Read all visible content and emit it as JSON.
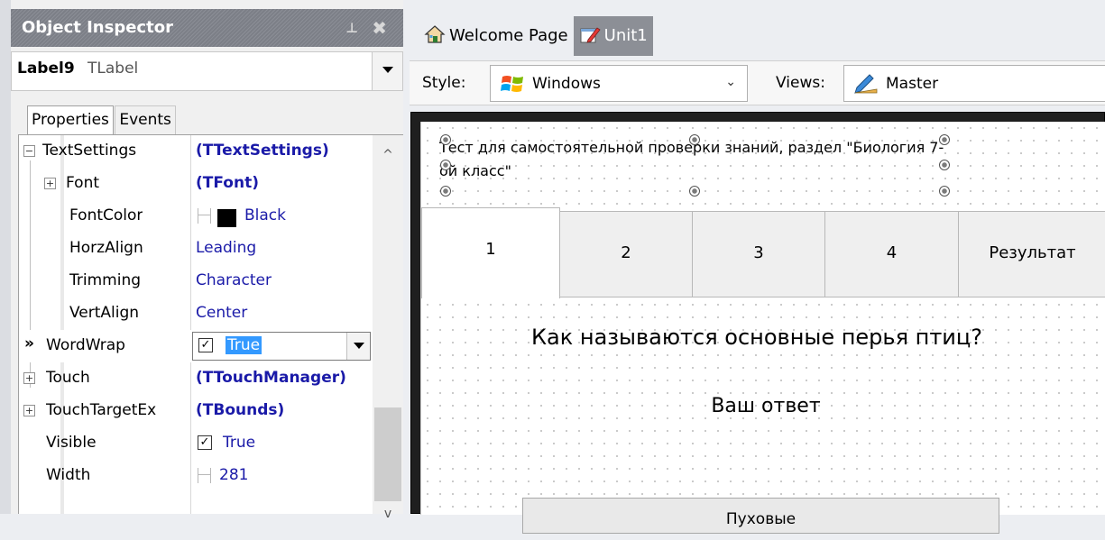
{
  "inspector": {
    "title": "Object Inspector",
    "pin_glyph": "⊥",
    "close_glyph": "✖",
    "selected_component": "Label9",
    "selected_class": "TLabel",
    "tabs": [
      "Properties",
      "Events"
    ],
    "focus_marker": "»",
    "properties": [
      {
        "name": "TextSettings",
        "value": "(TTextSettings)",
        "expander": "−"
      },
      {
        "name": "Font",
        "value": "(TFont)",
        "expander": "+"
      },
      {
        "name": "FontColor",
        "value": "Black"
      },
      {
        "name": "HorzAlign",
        "value": "Leading"
      },
      {
        "name": "Trimming",
        "value": "Character"
      },
      {
        "name": "VertAlign",
        "value": "Center"
      },
      {
        "name": "WordWrap",
        "value": "True"
      },
      {
        "name": "Touch",
        "value": "(TTouchManager)",
        "expander": "+"
      },
      {
        "name": "TouchTargetEx",
        "value": "(TBounds)",
        "expander": "+"
      },
      {
        "name": "Visible",
        "value": "True"
      },
      {
        "name": "Width",
        "value": "281"
      }
    ]
  },
  "designer": {
    "doc_tabs": [
      "Welcome Page",
      "Unit1"
    ],
    "active_doc_tab": "Unit1",
    "style_label": "Style:",
    "style_value": "Windows",
    "views_label": "Views:",
    "views_value": "Master",
    "form": {
      "label_text": "Тест для самостоятельной проверки знаний, раздел \"Биология 7-ой класс\"",
      "tabs": [
        "1",
        "2",
        "3",
        "4",
        "Результат"
      ],
      "active_tab": "1",
      "question": "Как называются основные перья птиц?",
      "answer_label": "Ваш ответ",
      "option_1": "Пуховые"
    }
  },
  "colors": {
    "title_bar": "#7c7f87",
    "property_value": "#1a1aa8",
    "selection": "#3399ff"
  }
}
